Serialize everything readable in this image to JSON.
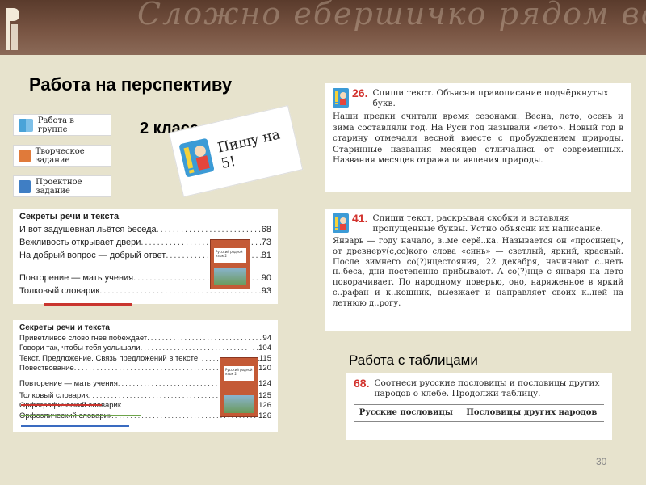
{
  "banner": {
    "script_text": "Сложно ебершичко рядом всего вершины вершин эботно ищем гетые"
  },
  "slide": {
    "title": "Работа на перспективу",
    "grade": "2 класс",
    "tables_label": "Работа с таблицами",
    "page_number": "30"
  },
  "legend": {
    "group": "Работа в группе",
    "creative": "Творческое задание",
    "project": "Проектное задание"
  },
  "stamp": {
    "text": "Пишу на 5!"
  },
  "toc1": {
    "title": "Секреты речи и текста",
    "rows": [
      {
        "t": "И вот задушевная льётся беседа",
        "p": "68"
      },
      {
        "t": "Вежливость открывает двери",
        "p": "73"
      },
      {
        "t": "На добрый вопрос — добрый ответ",
        "p": "81"
      },
      {
        "t": "Повторение — мать учения",
        "p": "90"
      },
      {
        "t": "Толковый словарик",
        "p": "93"
      }
    ]
  },
  "toc2": {
    "title": "Секреты речи и текста",
    "rows": [
      {
        "t": "Приветливое слово гнев побеждает",
        "p": "94"
      },
      {
        "t": "Говори так, чтобы тебя услышали",
        "p": "104"
      },
      {
        "t": "Текст. Предложение. Связь предложений в тексте",
        "p": "115"
      },
      {
        "t": "Повествование",
        "p": "120"
      },
      {
        "t": "Повторение — мать учения",
        "p": "124"
      },
      {
        "t": "Толковый словарик",
        "p": "125"
      },
      {
        "t": "Орфографический словарик",
        "p": "126"
      },
      {
        "t": "Орфоэпический словарик",
        "p": "126"
      }
    ]
  },
  "book_cover": {
    "text": "Русский родной язык 2"
  },
  "task26": {
    "num": "26.",
    "head": "Спиши текст. Объясни правописание подчёркнутых букв.",
    "body": "Наши предки считали время сезонами. Весна, лето, осень и зима составляли год. На Руси год называли «лето». Новый год в старину отмечали весной вместе с пробуждением природы. Старинные названия месяцев отличались от современных. Названия месяцев отражали явления природы."
  },
  "task41": {
    "num": "41.",
    "head": "Спиши текст, раскрывая скобки и вставляя пропущенные буквы. Устно объясни их написание.",
    "body": "Январь — году начало, з..ме серё..ка. Называется он «просинец», от древнеру(с,сс)кого слова «синь» — светлый, яркий, красный. После зимнего со(?)нцестояния, 22 декабря, начинают с..неть н..беса, дни постепенно прибывают. А со(?)нце с января на лето поворачивает. По народному поверью, оно, наряженное в яркий с..рафан и к..кошник, выезжает и направляет своих к..ней на летнюю д..рогу."
  },
  "task68": {
    "num": "68.",
    "head": "Соотнеси русские пословицы и пословицы других народов о хлебе. Продолжи таблицу.",
    "col1": "Русские пословицы",
    "col2": "Пословицы других народов"
  },
  "colors": {
    "banner": "#6b4736",
    "task_number": "#d2322d",
    "underline_red": "#c9352e",
    "underline_green": "#6da44a",
    "underline_blue": "#3a6bc0"
  }
}
